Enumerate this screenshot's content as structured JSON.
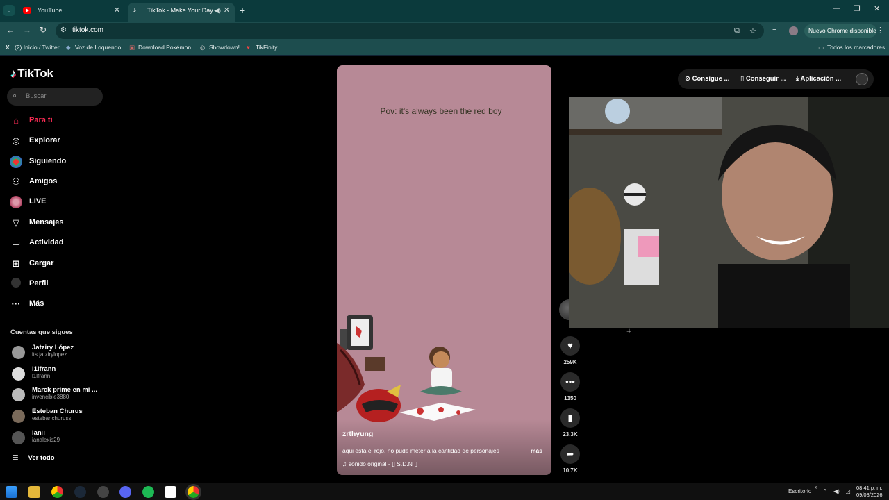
{
  "browser": {
    "tabs": [
      {
        "title": "YouTube",
        "active": false
      },
      {
        "title": "TikTok - Make Your Day",
        "active": true
      }
    ],
    "url": "tiktok.com",
    "update_label": "Nuevo Chrome disponible",
    "bookmarks": [
      {
        "label": "(2) Inicio / Twitter",
        "icon": "x-icon"
      },
      {
        "label": "Voz de Loquendo",
        "icon": "bookmark-icon"
      },
      {
        "label": "Download Pokémon...",
        "icon": "bookmark-icon"
      },
      {
        "label": "Showdown!",
        "icon": "bookmark-icon"
      },
      {
        "label": "TikFinity",
        "icon": "bookmark-icon"
      }
    ],
    "all_bookmarks": "Todos los marcadores"
  },
  "tiktok": {
    "logo": "TikTok",
    "search_placeholder": "Buscar",
    "nav": [
      {
        "label": "Para ti",
        "icon": "home-icon"
      },
      {
        "label": "Explorar",
        "icon": "compass-icon"
      },
      {
        "label": "Siguiendo",
        "icon": "following-icon"
      },
      {
        "label": "Amigos",
        "icon": "friends-icon"
      },
      {
        "label": "LIVE",
        "icon": "live-icon"
      },
      {
        "label": "Mensajes",
        "icon": "messages-icon"
      },
      {
        "label": "Actividad",
        "icon": "activity-icon"
      },
      {
        "label": "Cargar",
        "icon": "upload-icon"
      },
      {
        "label": "Perfil",
        "icon": "profile-icon"
      },
      {
        "label": "Más",
        "icon": "more-icon"
      }
    ],
    "following_title": "Cuentas que sigues",
    "following": [
      {
        "name": "Jatziry López",
        "handle": "its.jatzirylopez"
      },
      {
        "name": "l1lfrann",
        "handle": "l1lfrann"
      },
      {
        "name": "Marck prime en mi ...",
        "handle": "invencible3880"
      },
      {
        "name": "Esteban Churus",
        "handle": "estebanchuruss"
      },
      {
        "name": "ian▯",
        "handle": "ianalexis29"
      }
    ],
    "see_all": "Ver todo",
    "top_actions": [
      {
        "label": "Consigue ...",
        "icon": "coin-icon"
      },
      {
        "label": "Conseguir ...",
        "icon": "phone-icon"
      },
      {
        "label": "Aplicación ...",
        "icon": "download-icon"
      }
    ],
    "video": {
      "overlay_text": "Pov: it's always been the red boy",
      "username": "zrthyung",
      "description": "aqui está el rojo, no pude meter a la cantidad de personajes",
      "more": "más",
      "sound": "sonido original - ▯ S.D.N ▯"
    },
    "actions": [
      {
        "icon": "heart-icon",
        "count": "259K"
      },
      {
        "icon": "comment-icon",
        "count": "1350"
      },
      {
        "icon": "bookmark-icon",
        "count": "23.3K"
      },
      {
        "icon": "share-icon",
        "count": "10.7K"
      }
    ]
  },
  "taskbar": {
    "desktop_label": "Escritorio",
    "time": "08:41 p. m.",
    "date": "09/03/2026"
  },
  "colors": {
    "accent": "#fe2c55",
    "chrome_bg": "#1d4d4e",
    "video_bg": "#b78996"
  }
}
